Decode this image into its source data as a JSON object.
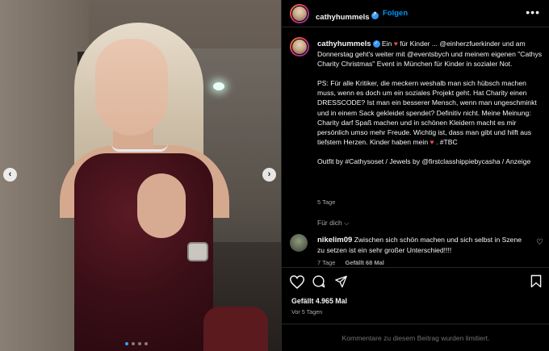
{
  "post": {
    "username": "cathyhummels",
    "follow_label": "Folgen",
    "more_icon": "more-horizontal-icon",
    "separator": "•"
  },
  "caption": {
    "username": "cathyhummels",
    "line1_pre": " Ein ",
    "line1_post": " für Kinder ... @einherzfuerkinder und am Donnerstag geht's weiter mit @eventsbych und meinem eigenen \"Cathys Charity Christmas\" Event in München für Kinder in sozialer Not.",
    "para2": "PS: Für alle Kritiker, die meckern weshalb man sich hübsch machen muss, wenn es doch um ein soziales Projekt geht. Hat Charity einen DRESSCODE? Ist man ein besserer Mensch, wenn man ungeschminkt und in einem Sack gekleidet spendet? Definitiv nicht. Meine Meinung: Charity darf Spaß machen und in schönen Kleidern macht es mir persönlich umso mehr Freude. Wichtig ist, dass man gibt und hilft aus tiefstem Herzen. Kinder haben mein ",
    "para2_end": " . #TBC",
    "para3": "Outfit by #Cathysoset / Jewels by @firstclasshippiebycasha / Anzeige",
    "time": "5 Tage",
    "heart_char": "♥"
  },
  "for_you": "Für dich",
  "comment": {
    "username": "nikelim09",
    "text": " Zwischen sich schön machen und sich selbst in Szene zu setzen ist ein sehr großer Unterschied!!!!",
    "time": "7 Tage",
    "likes": "Gefällt 68 Mal"
  },
  "stats": {
    "likes": "Gefällt 4.965 Mal",
    "time": "Vor 5 Tagen"
  },
  "comments_limited": "Kommentare zu diesem Beitrag wurden limitiert.",
  "carousel": {
    "slides": 4,
    "active": 0
  },
  "colors": {
    "accent": "#0095f6",
    "heart": "#ed4956",
    "verified": "#3897f0"
  }
}
